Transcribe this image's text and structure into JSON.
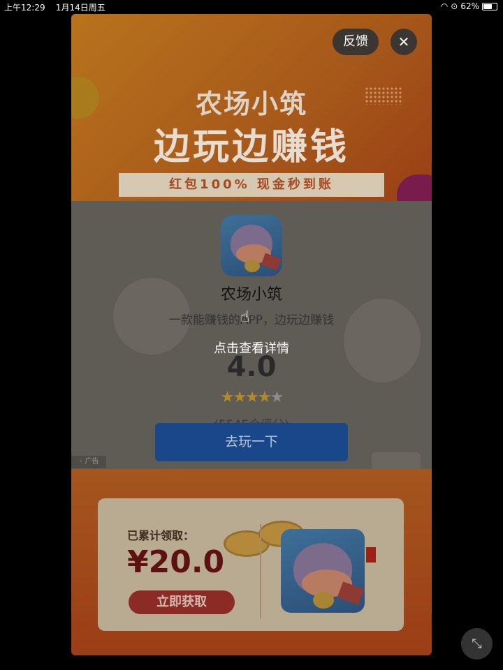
{
  "status_bar": {
    "time": "上午12:29",
    "date": "1月14日周五",
    "battery": "62%"
  },
  "banner": {
    "title_line1": "农场小筑",
    "title_line2": "边玩边赚钱",
    "ribbon": "红包100%   现金秒到账"
  },
  "app": {
    "name": "农场小筑",
    "description": "一款能赚钱的APP，边玩边赚钱",
    "rating": "4.0",
    "rating_value": 4,
    "rating_max": 5,
    "rating_count": "(5545个评分)",
    "cta_label": "去玩一下",
    "ad_tag": "广告"
  },
  "reward": {
    "claimed_label": "已累计领取：",
    "amount": "¥20.0",
    "claim_label": "立即获取"
  },
  "overlay": {
    "feedback_label": "反馈",
    "hint": "点击查看详情"
  },
  "icons": {
    "close": "close-icon",
    "minimize": "minimize-icon",
    "wifi": "wifi-icon",
    "battery": "battery-icon",
    "hand": "tap-hand-icon"
  }
}
